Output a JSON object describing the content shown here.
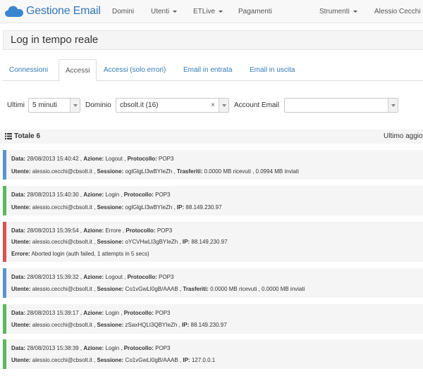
{
  "navbar": {
    "brand": "Gestione Email",
    "items": [
      {
        "label": "Domini",
        "dropdown": false
      },
      {
        "label": "Utenti",
        "dropdown": true
      },
      {
        "label": "ETLive",
        "dropdown": true
      },
      {
        "label": "Pagamenti",
        "dropdown": false
      },
      {
        "label": "Strumenti",
        "dropdown": true
      },
      {
        "label": "Alessio Cecchi",
        "dropdown": false
      }
    ]
  },
  "page": {
    "title": "Log in tempo reale"
  },
  "tabs": [
    {
      "label": "Connessioni",
      "active": false
    },
    {
      "label": "Accessi",
      "active": true
    },
    {
      "label": "Accessi (solo errori)",
      "active": false
    },
    {
      "label": "Email in entrata",
      "active": false
    },
    {
      "label": "Email in uscita",
      "active": false
    }
  ],
  "filters": {
    "ultimi_label": "Ultimi",
    "ultimi_value": "5 minuti",
    "dominio_label": "Dominio",
    "dominio_value": "cbsolt.it (16)",
    "dominio_clear": "×",
    "account_label": "Account Email",
    "account_value": ""
  },
  "summary": {
    "total": "Totale 6",
    "last_update": "Ultimo aggio"
  },
  "labels": {
    "data": "Data:",
    "azione": "Azione:",
    "protocollo": "Protocollo:",
    "utente": "Utente:",
    "sessione": "Sessione:",
    "trasferiti": "Trasferiti:",
    "ip": "IP:",
    "errore": "Errore:"
  },
  "colors": {
    "logout": "#5a95d1",
    "login": "#5cb85c",
    "error": "#d9534f",
    "brand": "#3477b8"
  },
  "logs": [
    {
      "type": "logout",
      "data": "28/08/2013 15:40:42",
      "azione": "Logout",
      "protocollo": "POP3",
      "utente": "alessio.cecchi@cbsolt.it",
      "sessione": "oglGlgLI3wBYIeZh",
      "trasferiti": "0.0000 MB ricevuti , 0.0994 MB inviati"
    },
    {
      "type": "login",
      "data": "28/08/2013 15:40:30",
      "azione": "Login",
      "protocollo": "POP3",
      "utente": "alessio.cecchi@cbsolt.it",
      "sessione": "oglGlgLI3wBYIeZh",
      "ip": "88.149.230.97"
    },
    {
      "type": "error",
      "data": "28/08/2013 15:39:54",
      "azione": "Errore",
      "protocollo": "POP3",
      "utente": "alessio.cecchi@cbsolt.it",
      "sessione": "oYCVHwLI3gBYIeZh",
      "ip": "88.149.230.97",
      "errore": "Aborted login (auth failed, 1 attempts in 5 secs)"
    },
    {
      "type": "logout",
      "data": "28/08/2013 15:39:32",
      "azione": "Logout",
      "protocollo": "POP3",
      "utente": "alessio.cecchi@cbsolt.it",
      "sessione": "Co1vGwLI0gB/AAAB",
      "trasferiti": "0.0000 MB ricevuti , 0.0000 MB inviati"
    },
    {
      "type": "login",
      "data": "28/08/2013 15:39:17",
      "azione": "Login",
      "protocollo": "POP3",
      "utente": "alessio.cecchi@cbsolt.it",
      "sessione": "zSaxHQLI3QBYIeZh",
      "ip": "88.149.230.97"
    },
    {
      "type": "login",
      "data": "28/08/2013 15:38:39",
      "azione": "Login",
      "protocollo": "POP3",
      "utente": "alessio.cecchi@cbsolt.it",
      "sessione": "Co1vGwLI0gB/AAAB",
      "ip": "127.0.0.1"
    }
  ]
}
